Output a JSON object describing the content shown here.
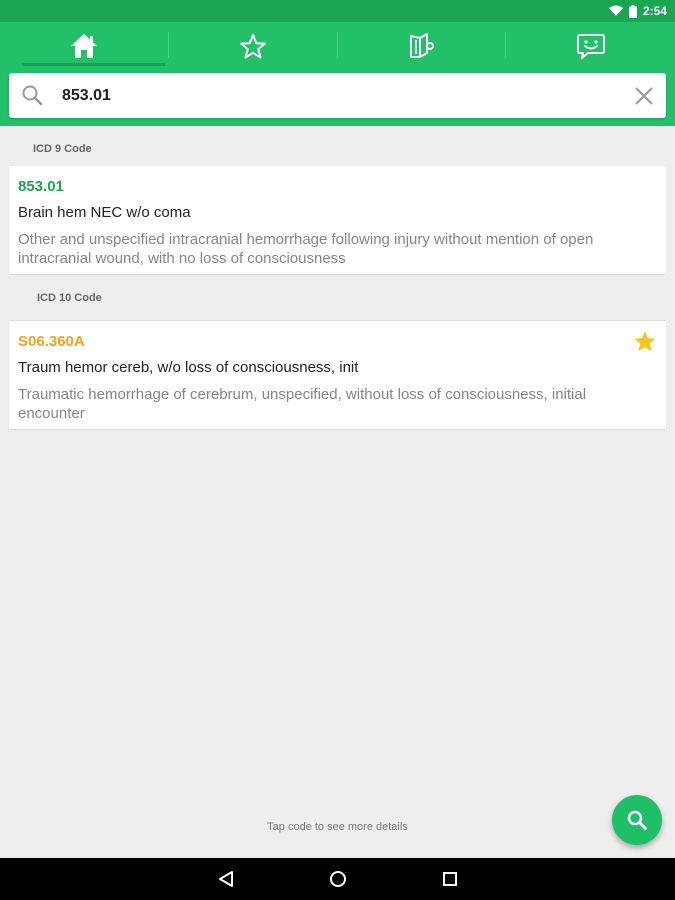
{
  "status_bar": {
    "time": "2:54"
  },
  "tabs": [
    {
      "name": "home",
      "icon": "home-icon",
      "active": true
    },
    {
      "name": "favorites",
      "icon": "star-outline-icon",
      "active": false
    },
    {
      "name": "book",
      "icon": "book-icon",
      "active": false
    },
    {
      "name": "feedback",
      "icon": "smiley-chat-icon",
      "active": false
    }
  ],
  "search": {
    "value": "853.01",
    "placeholder": ""
  },
  "results": {
    "icd9": {
      "header": "ICD 9 Code",
      "code": "853.01",
      "short": "Brain hem NEC w/o coma",
      "long": "Other and unspecified intracranial hemorrhage following injury without mention of open intracranial wound, with no loss of consciousness"
    },
    "icd10": {
      "header": "ICD 10 Code",
      "code": "S06.360A",
      "short": "Traum hemor cereb, w/o loss of consciousness, init",
      "long": "Traumatic hemorrhage of cerebrum, unspecified, without loss of consciousness, initial encounter",
      "favorited": true
    }
  },
  "footer": {
    "hint": "Tap code to see more details"
  },
  "colors": {
    "primary": "#23c06a",
    "primary_dark": "#1aa553",
    "accent_orange": "#f5a11d",
    "star": "#f5c518"
  }
}
